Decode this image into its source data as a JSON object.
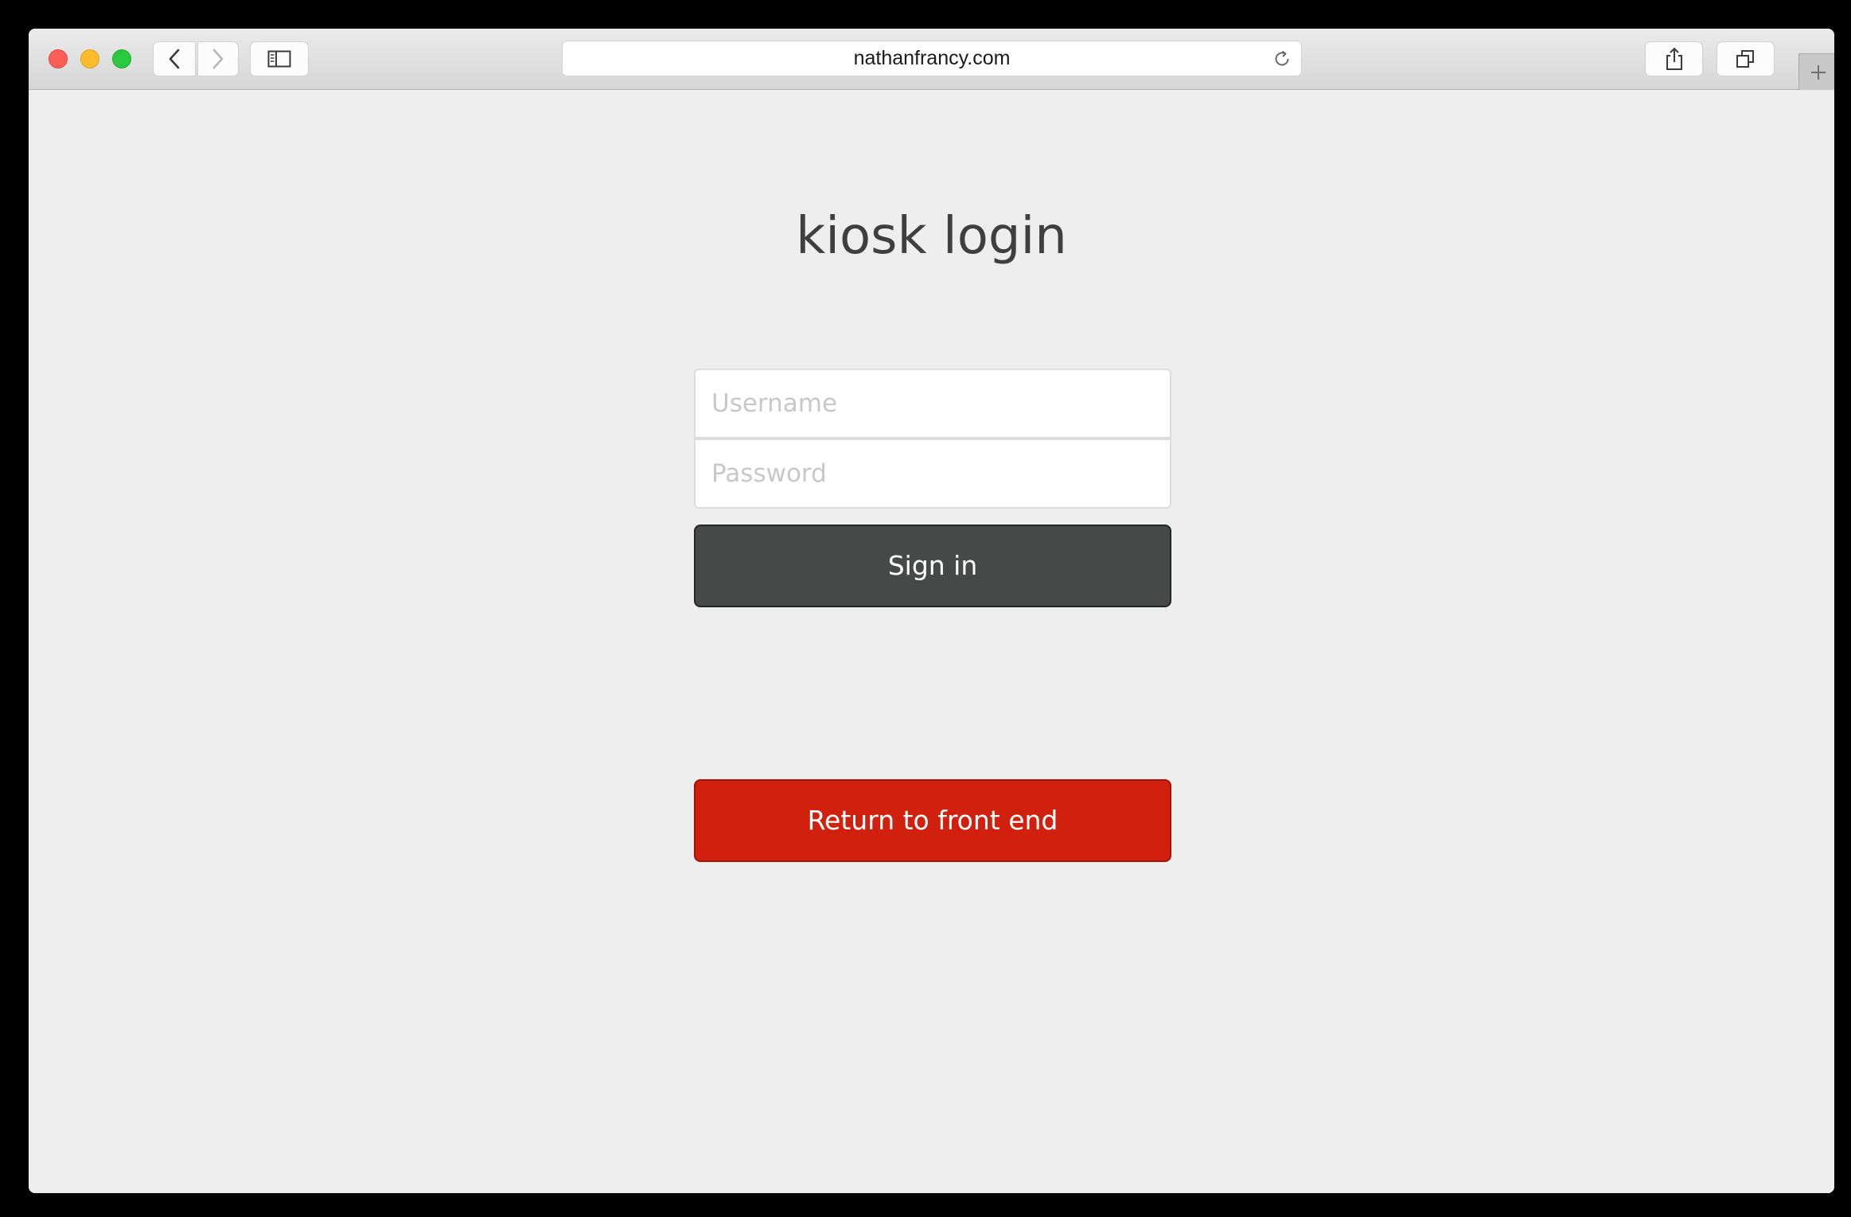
{
  "browser": {
    "url": "nathanfrancy.com"
  },
  "page": {
    "title": "kiosk login",
    "username_placeholder": "Username",
    "password_placeholder": "Password",
    "signin_label": "Sign in",
    "return_label": "Return to front end"
  },
  "colors": {
    "page_background": "#eeeeee",
    "signin_button": "#474848",
    "return_button": "#d2200e"
  },
  "icons": [
    "close-button",
    "minimize-button",
    "zoom-button",
    "chevron-left-icon",
    "chevron-right-icon",
    "sidebar-icon",
    "reload-icon",
    "share-icon",
    "tabs-icon",
    "plus-icon"
  ]
}
